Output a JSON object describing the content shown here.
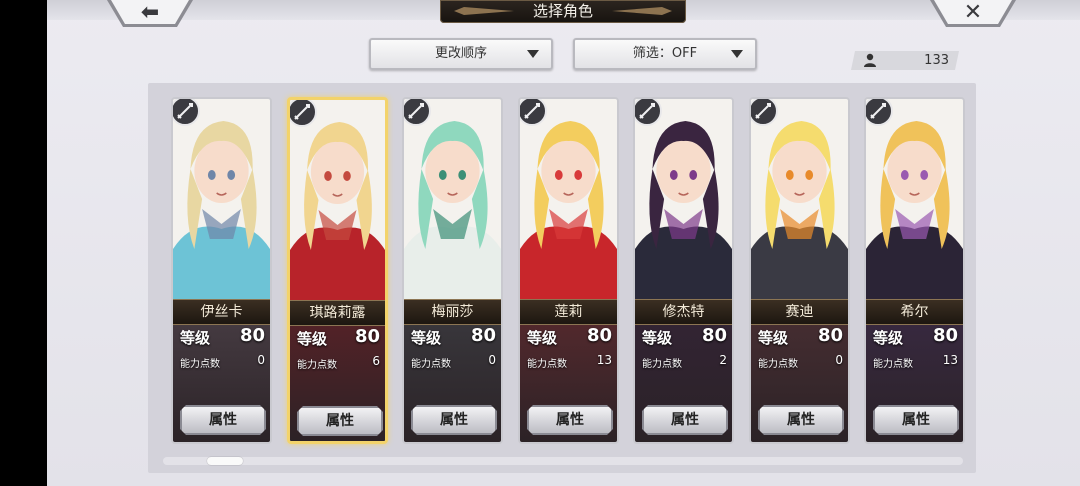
{
  "header": {
    "title": "选择角色",
    "back_glyph": "⬅",
    "close_glyph": "✕"
  },
  "controls": {
    "sort_label": "更改顺序",
    "filter_label": "筛选：OFF",
    "character_count": "133"
  },
  "icons": [
    "back-arrow-icon",
    "close-icon",
    "dropdown-arrow-icon",
    "person-icon",
    "weapon-class-icon"
  ],
  "labels": {
    "level": "等级",
    "ability_points": "能力点数",
    "attributes_button": "属性"
  },
  "characters": [
    {
      "name": "伊丝卡",
      "level": "80",
      "ability_points": "0",
      "selected": false,
      "accent": "#6f86a8",
      "hair": "#e8d7a2",
      "outfit": "#6dc3d6",
      "stat_bg": "#4a3f46"
    },
    {
      "name": "琪路莉露",
      "level": "80",
      "ability_points": "6",
      "selected": true,
      "accent": "#c44a3f",
      "hair": "#f1d58f",
      "outfit": "#b8232a",
      "stat_bg": "#5b2227"
    },
    {
      "name": "梅丽莎",
      "level": "80",
      "ability_points": "0",
      "selected": false,
      "accent": "#3c8f76",
      "hair": "#8fd8be",
      "outfit": "#e8eeea",
      "stat_bg": "#3b3a3f"
    },
    {
      "name": "莲莉",
      "level": "80",
      "ability_points": "13",
      "selected": false,
      "accent": "#d83a3a",
      "hair": "#f3cd5e",
      "outfit": "#c8262b",
      "stat_bg": "#5a2a2e"
    },
    {
      "name": "修杰特",
      "level": "80",
      "ability_points": "2",
      "selected": false,
      "accent": "#7d3a8a",
      "hair": "#3a2540",
      "outfit": "#2a2a3a",
      "stat_bg": "#342436"
    },
    {
      "name": "赛迪",
      "level": "80",
      "ability_points": "0",
      "selected": false,
      "accent": "#e88a2a",
      "hair": "#f5dc6e",
      "outfit": "#3a3a44",
      "stat_bg": "#4a2f33"
    },
    {
      "name": "希尔",
      "level": "80",
      "ability_points": "13",
      "selected": false,
      "accent": "#9a5ab0",
      "hair": "#f0c25a",
      "outfit": "#2b2436",
      "stat_bg": "#3a2a44"
    }
  ]
}
